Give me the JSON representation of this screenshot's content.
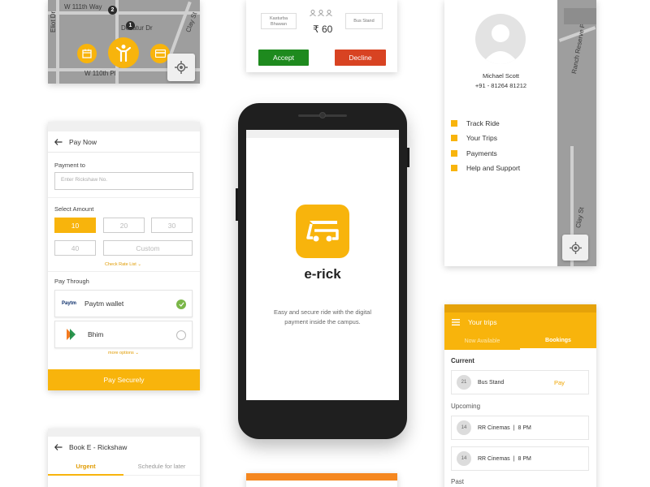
{
  "map": {
    "street_top": "W 111th Way",
    "street_bottom": "W 110th Pl",
    "street_left": "Eliot Dr",
    "street_mid": "Decatur Dr",
    "street_right": "Clay St",
    "pin1": "2",
    "pin2": "1"
  },
  "ride": {
    "from": "Kasturba Bhawan",
    "to": "Bus Stand",
    "fare": "₹ 60",
    "accept_label": "Accept",
    "decline_label": "Decline"
  },
  "profile": {
    "name": "Michael Scott",
    "phone": "+91 - 81264 81212",
    "menu": [
      "Track Ride",
      "Your Trips",
      "Payments",
      "Help and Support"
    ],
    "street_a": "Ranch Reserve Pkwy",
    "street_b": "Clay St"
  },
  "pay": {
    "title": "Pay Now",
    "payment_to_label": "Payment to",
    "rickshaw_placeholder": "Enter Rickshaw No.",
    "select_amount_label": "Select Amount",
    "amounts": [
      "10",
      "20",
      "30",
      "40"
    ],
    "custom_label": "Custom",
    "check_rate_link": "Check Rate List ⌄",
    "pay_through_label": "Pay Through",
    "paytm_logo": "Paytm",
    "paytm_label": "Paytm wallet",
    "bhim_label": "Bhim",
    "more_options_link": "more options ⌄",
    "pay_button": "Pay Securely"
  },
  "book": {
    "title": "Book E - Rickshaw",
    "tab_urgent": "Urgent",
    "tab_schedule": "Schedule for later"
  },
  "splash": {
    "app_name": "e-rick",
    "tagline_1": "Easy and secure ride with the digital",
    "tagline_2": "payment inside the campus."
  },
  "trips": {
    "title": "Your trips",
    "tab_now": "Now Available",
    "tab_bookings": "Bookings",
    "current_label": "Current",
    "upcoming_label": "Upcoming",
    "past_label": "Past",
    "current": {
      "date": "21",
      "place": "Bus Stand",
      "action": "Pay"
    },
    "upcoming": [
      {
        "date": "14",
        "place": "RR Cinemas",
        "time": "8 PM"
      },
      {
        "date": "14",
        "place": "RR Cinemas",
        "time": "8 PM"
      }
    ]
  },
  "colors": {
    "accent": "#f8b40c",
    "accept": "#1e8a1e",
    "decline": "#d84322",
    "map_bg": "#9e9e9e",
    "phone_body": "#1f1f1f"
  }
}
